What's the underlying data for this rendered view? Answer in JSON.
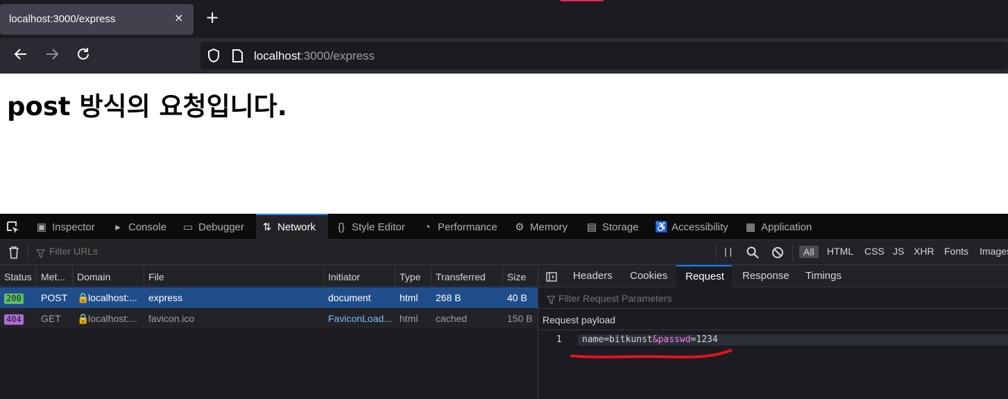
{
  "browser": {
    "tab_title": "localhost:3000/express",
    "tab_close": "×",
    "new_tab": "+",
    "url_host": "localhost",
    "url_path": ":3000/express"
  },
  "page": {
    "heading": "post 방식의 요청입니다."
  },
  "devtools": {
    "tabs": [
      {
        "label": "Inspector",
        "icon": "inspector-icon"
      },
      {
        "label": "Console",
        "icon": "console-icon"
      },
      {
        "label": "Debugger",
        "icon": "debugger-icon"
      },
      {
        "label": "Network",
        "icon": "network-icon",
        "active": true
      },
      {
        "label": "Style Editor",
        "icon": "style-editor-icon"
      },
      {
        "label": "Performance",
        "icon": "performance-icon"
      },
      {
        "label": "Memory",
        "icon": "memory-icon"
      },
      {
        "label": "Storage",
        "icon": "storage-icon"
      },
      {
        "label": "Accessibility",
        "icon": "accessibility-icon"
      },
      {
        "label": "Application",
        "icon": "application-icon"
      }
    ],
    "toolbar": {
      "filter_placeholder": "Filter URLs",
      "pause": "| |",
      "type_filters": [
        "All",
        "HTML",
        "CSS",
        "JS",
        "XHR",
        "Fonts",
        "Images"
      ]
    },
    "columns": [
      "Status",
      "Met...",
      "Domain",
      "File",
      "Initiator",
      "Type",
      "Transferred",
      "Size"
    ],
    "requests": [
      {
        "status": "200",
        "method": "POST",
        "domain": "localhost:...",
        "file": "express",
        "initiator": "document",
        "type": "html",
        "transferred": "268 B",
        "size": "40 B",
        "status_color": "#5ec263",
        "selected": true
      },
      {
        "status": "404",
        "method": "GET",
        "domain": "localhost:...",
        "file": "favicon.ico",
        "initiator": "FaviconLoad...",
        "type": "html",
        "transferred": "cached",
        "size": "150 B",
        "status_color": "#b06cd7",
        "selected": false
      }
    ],
    "side_panel": {
      "tabs": [
        "Headers",
        "Cookies",
        "Request",
        "Response",
        "Timings"
      ],
      "active_tab": "Request",
      "filter_placeholder": "Filter Request Parameters",
      "payload_label": "Request payload",
      "line_number": "1",
      "payload_name": "name=bitkunst",
      "payload_amp": "&passwd",
      "payload_rest": "=1234"
    }
  },
  "colors": {
    "accent_blue": "#0a84ff",
    "selected_row": "#204e8a",
    "annotation_red": "#e0141e"
  }
}
